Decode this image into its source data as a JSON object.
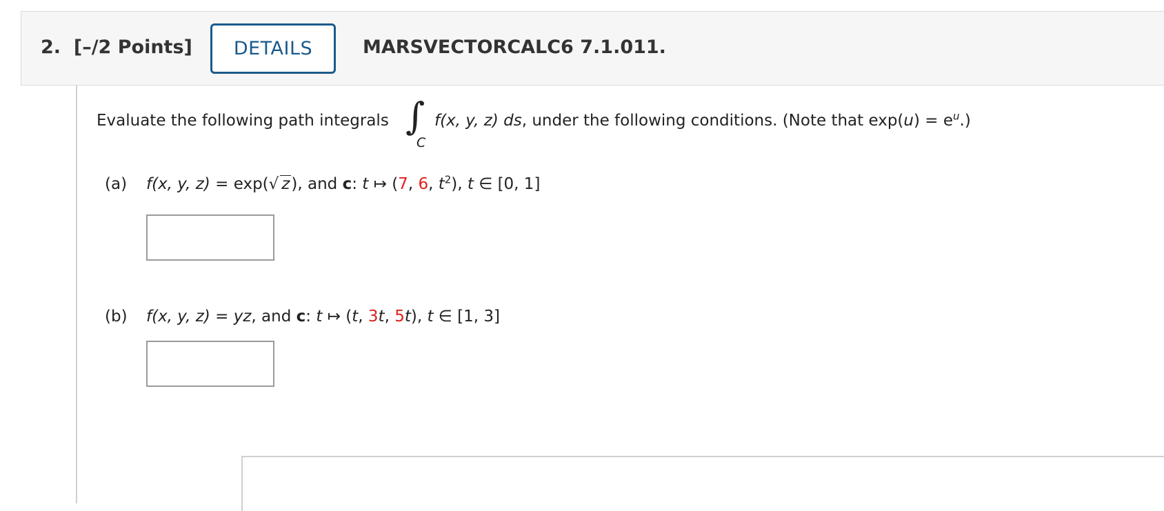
{
  "header": {
    "question_number": "2.",
    "points": "[–/2 Points]",
    "details_label": "DETAILS",
    "question_id": "MARSVECTORCALC6 7.1.011."
  },
  "prompt": {
    "lead": "Evaluate the following path integrals",
    "integral_symbol": "∫",
    "integral_subscript": "C",
    "f_expr": "f(x, y, z) ds",
    "tail": ", under the following conditions. (Note that exp(",
    "u_var": "u",
    "tail2": ") = e",
    "exp_sup": "u",
    "tail3": ".)"
  },
  "part_a": {
    "label": "(a)",
    "f": "f(x, y, z)",
    "eq": " = exp(",
    "sqrt_arg": "z",
    "after_sqrt": "), and ",
    "c_bold": "c",
    "colon": ": ",
    "t": "t",
    "maps": " ↦ (",
    "v1": "7",
    "comma1": ", ",
    "v2": "6",
    "comma2": ", ",
    "t2": "t",
    "t2_sup": "2",
    "close": "), ",
    "t_dom": "t",
    "domain": " ∈ [0, 1]"
  },
  "part_b": {
    "label": "(b)",
    "f": "f(x, y, z)",
    "eq": " = ",
    "yz": "yz",
    "and": ", and ",
    "c_bold": "c",
    "colon": ": ",
    "t": "t",
    "maps": " ↦ (",
    "t_first": "t",
    "comma1": ", ",
    "v2": "3",
    "t_second": "t",
    "comma2": ", ",
    "v3": "5",
    "t_third": "t",
    "close": "), ",
    "t_dom": "t",
    "domain": " ∈ [1, 3]"
  },
  "colors": {
    "accent": "#1a5a8c",
    "red_value": "#e0201b"
  }
}
